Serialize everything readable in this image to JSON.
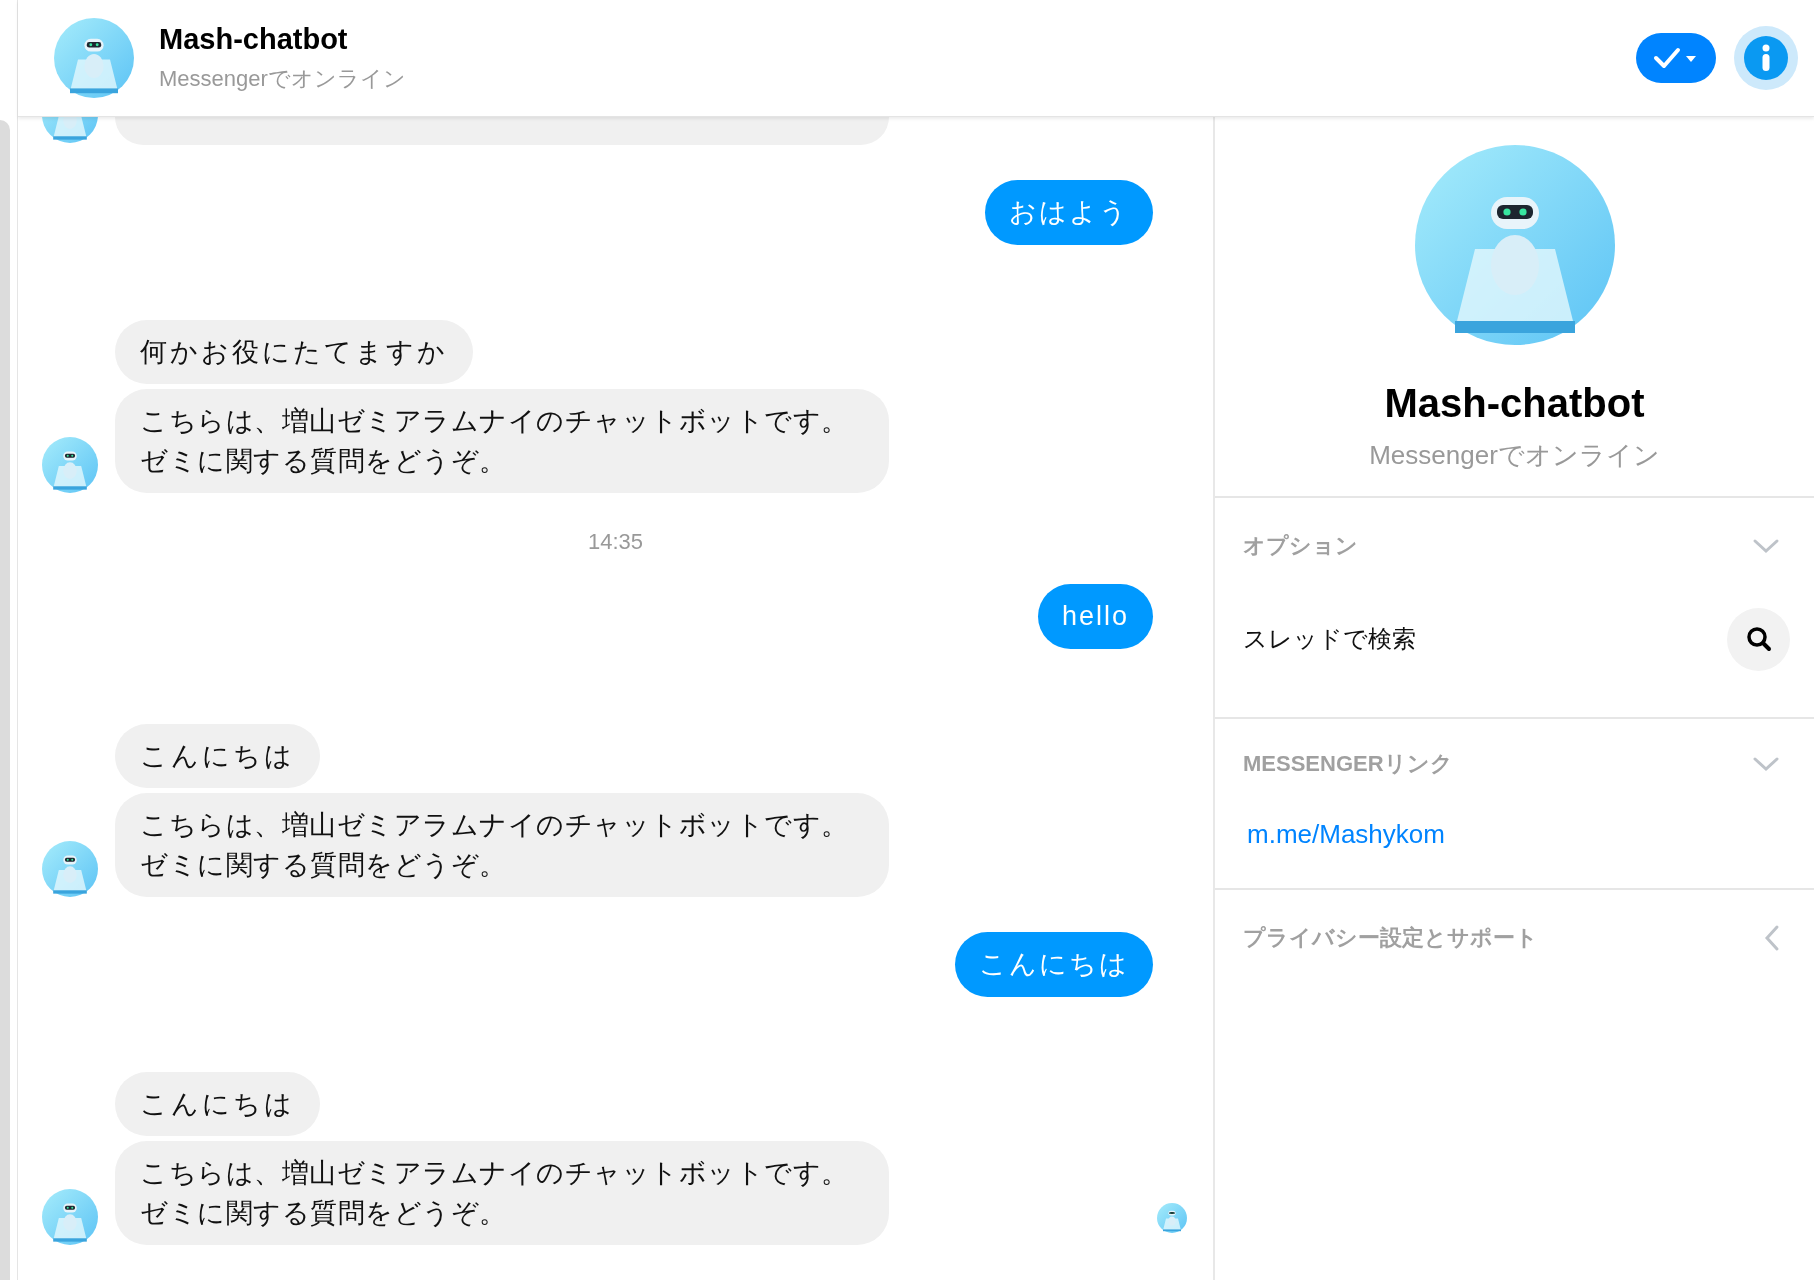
{
  "header": {
    "name": "Mash-chatbot",
    "status": "Messengerでオンライン"
  },
  "messages": [
    {
      "kind": "cut"
    },
    {
      "kind": "out",
      "text": "おはよう"
    },
    {
      "kind": "in",
      "texts": [
        "何かお役にたてますか",
        "こちらは、増山ゼミアラムナイのチャットボットです。ゼミに関する質問をどうぞ。"
      ]
    },
    {
      "kind": "time",
      "text": "14:35"
    },
    {
      "kind": "out",
      "text": "hello"
    },
    {
      "kind": "in",
      "texts": [
        "こんにちは",
        "こちらは、増山ゼミアラムナイのチャットボットです。ゼミに関する質問をどうぞ。"
      ]
    },
    {
      "kind": "out",
      "text": "こんにちは"
    },
    {
      "kind": "in",
      "texts": [
        "こんにちは",
        "こちらは、増山ゼミアラムナイのチャットボットです。ゼミに関する質問をどうぞ。"
      ]
    }
  ],
  "profile": {
    "name": "Mash-chatbot",
    "status": "Messengerでオンライン"
  },
  "sections": [
    {
      "title": "オプション",
      "expanded": true,
      "items": [
        {
          "kind": "search",
          "label": "スレッドで検索"
        }
      ]
    },
    {
      "title": "MESSENGERリンク",
      "expanded": true,
      "items": [
        {
          "kind": "link",
          "label": "m.me/Mashykom"
        }
      ]
    },
    {
      "title": "プライバシー設定とサポート",
      "expanded": false
    }
  ]
}
